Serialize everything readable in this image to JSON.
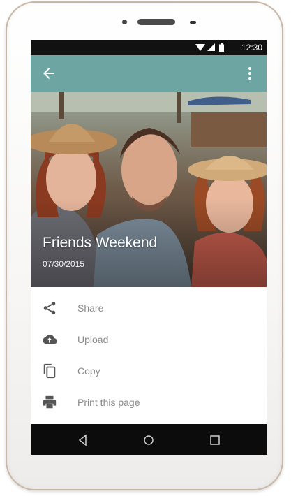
{
  "status_bar": {
    "time": "12:30",
    "icons": [
      "wifi-icon",
      "signal-icon",
      "battery-icon"
    ]
  },
  "app_bar": {
    "background": "#6ca5a1",
    "back_icon": "arrow-back-icon",
    "overflow_icon": "more-vert-icon"
  },
  "photo": {
    "title": "Friends Weekend",
    "date": "07/30/2015"
  },
  "menu": {
    "items": [
      {
        "label": "Share",
        "icon": "share-icon"
      },
      {
        "label": "Upload",
        "icon": "cloud-upload-icon"
      },
      {
        "label": "Copy",
        "icon": "copy-icon"
      },
      {
        "label": "Print this page",
        "icon": "print-icon"
      }
    ]
  },
  "nav_bar": {
    "buttons": [
      "back-triangle-icon",
      "home-circle-icon",
      "recents-square-icon"
    ]
  }
}
